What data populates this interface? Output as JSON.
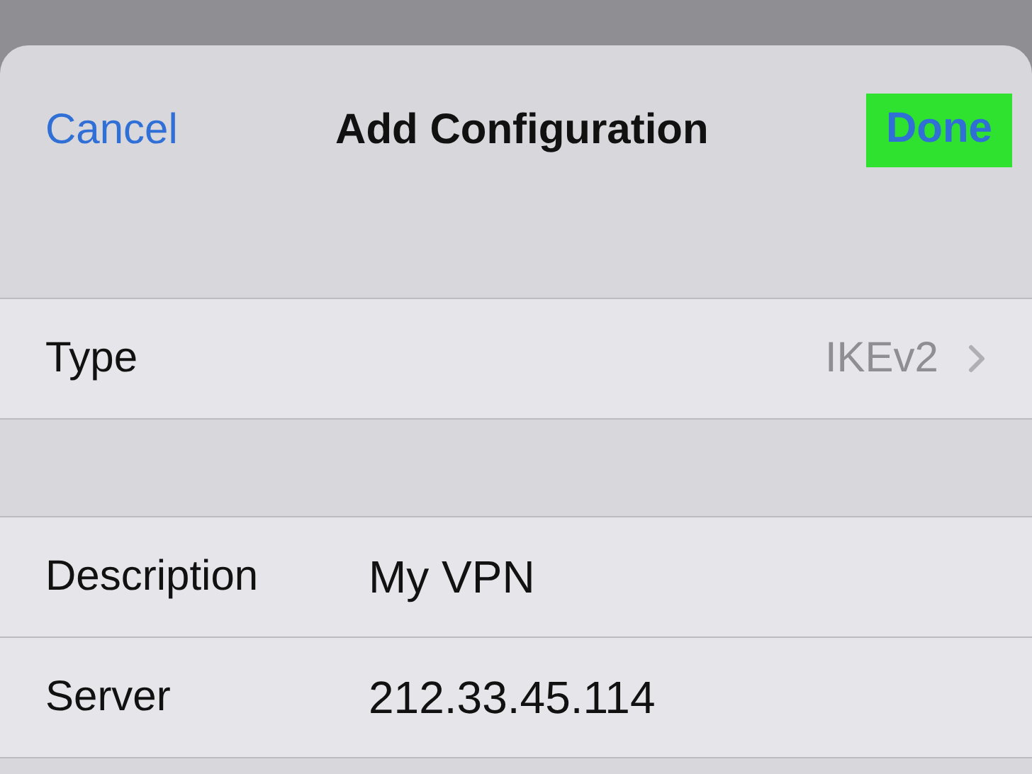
{
  "nav": {
    "cancel": "Cancel",
    "title": "Add Configuration",
    "done": {
      "label": "Done",
      "highlighted": true
    }
  },
  "groups": [
    {
      "rows": [
        {
          "kind": "disclosure",
          "label": "Type",
          "value": "IKEv2"
        }
      ]
    },
    {
      "rows": [
        {
          "kind": "field",
          "label": "Description",
          "value": "My VPN"
        },
        {
          "kind": "field",
          "label": "Server",
          "value": "212.33.45.114"
        }
      ]
    }
  ]
}
